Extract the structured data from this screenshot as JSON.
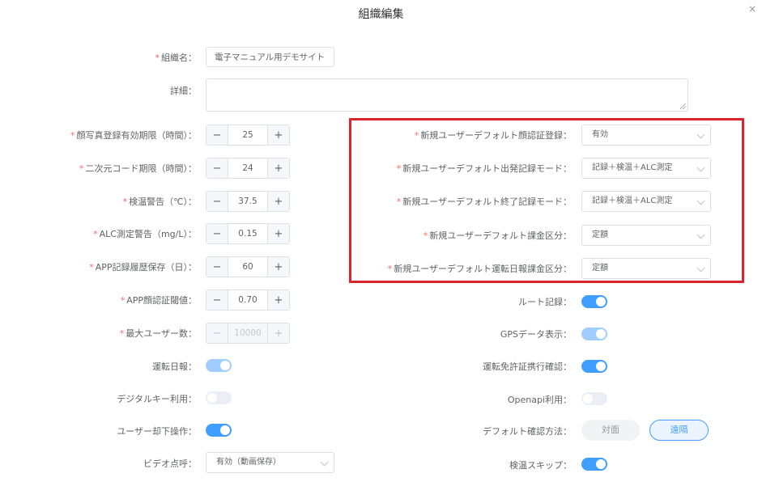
{
  "dialog": {
    "title": "組織編集",
    "close_symbol": "×"
  },
  "required_mark": "*",
  "fields": {
    "org_name": {
      "label": "組織名：",
      "value": "電子マニュアル用デモサイト"
    },
    "details": {
      "label": "詳細：",
      "value": ""
    },
    "face_photo_expiry": {
      "label": "顔写真登録有効期限（時間）：",
      "value": "25"
    },
    "qr_expiry": {
      "label": "二次元コード期限（時間）：",
      "value": "24"
    },
    "temp_warning": {
      "label": "検温警告（℃）：",
      "value": "37.5"
    },
    "alc_warning": {
      "label": "ALC測定警告（mg/L）：",
      "value": "0.15"
    },
    "app_record_retention": {
      "label": "APP記録履歴保存（日）：",
      "value": "60"
    },
    "app_face_threshold": {
      "label": "APP顔認証閾値：",
      "value": "0.70"
    },
    "max_users": {
      "label": "最大ユーザー数：",
      "value": "10000"
    },
    "driving_report": {
      "label": "運転日報：",
      "on": true,
      "disabled": true
    },
    "digital_key": {
      "label": "デジタルキー利用：",
      "on": false,
      "disabled": true
    },
    "user_reject": {
      "label": "ユーザー却下操作：",
      "on": true,
      "disabled": false
    },
    "video_call": {
      "label": "ビデオ点呼：",
      "value": "有効（動画保存）"
    },
    "default_face_auth": {
      "label": "新規ユーザーデフォルト顔認証登録：",
      "value": "有効"
    },
    "default_departure_mode": {
      "label": "新規ユーザーデフォルト出発記録モード：",
      "value": "記録＋検温＋ALC測定"
    },
    "default_end_mode": {
      "label": "新規ユーザーデフォルト終了記録モード：",
      "value": "記録＋検温＋ALC測定"
    },
    "default_billing": {
      "label": "新規ユーザーデフォルト課金区分：",
      "value": "定額"
    },
    "default_report_billing": {
      "label": "新規ユーザーデフォルト運転日報課金区分：",
      "value": "定額"
    },
    "route_record": {
      "label": "ルート記録：",
      "on": true,
      "disabled": false
    },
    "gps_display": {
      "label": "GPSデータ表示：",
      "on": true,
      "disabled": true
    },
    "license_check": {
      "label": "運転免許証携行確認：",
      "on": true,
      "disabled": false
    },
    "openapi": {
      "label": "Openapi利用：",
      "on": false,
      "disabled": true
    },
    "default_confirm_method": {
      "label": "デフォルト確認方法：",
      "options": [
        "対面",
        "遠隔"
      ],
      "selected": "遠隔"
    },
    "temp_skip": {
      "label": "検温スキップ：",
      "on": true,
      "disabled": false
    }
  },
  "stepper_symbols": {
    "minus": "−",
    "plus": "+"
  },
  "colors": {
    "accent": "#409eff",
    "required": "#f56c6c",
    "highlight_border": "#d9232d"
  }
}
